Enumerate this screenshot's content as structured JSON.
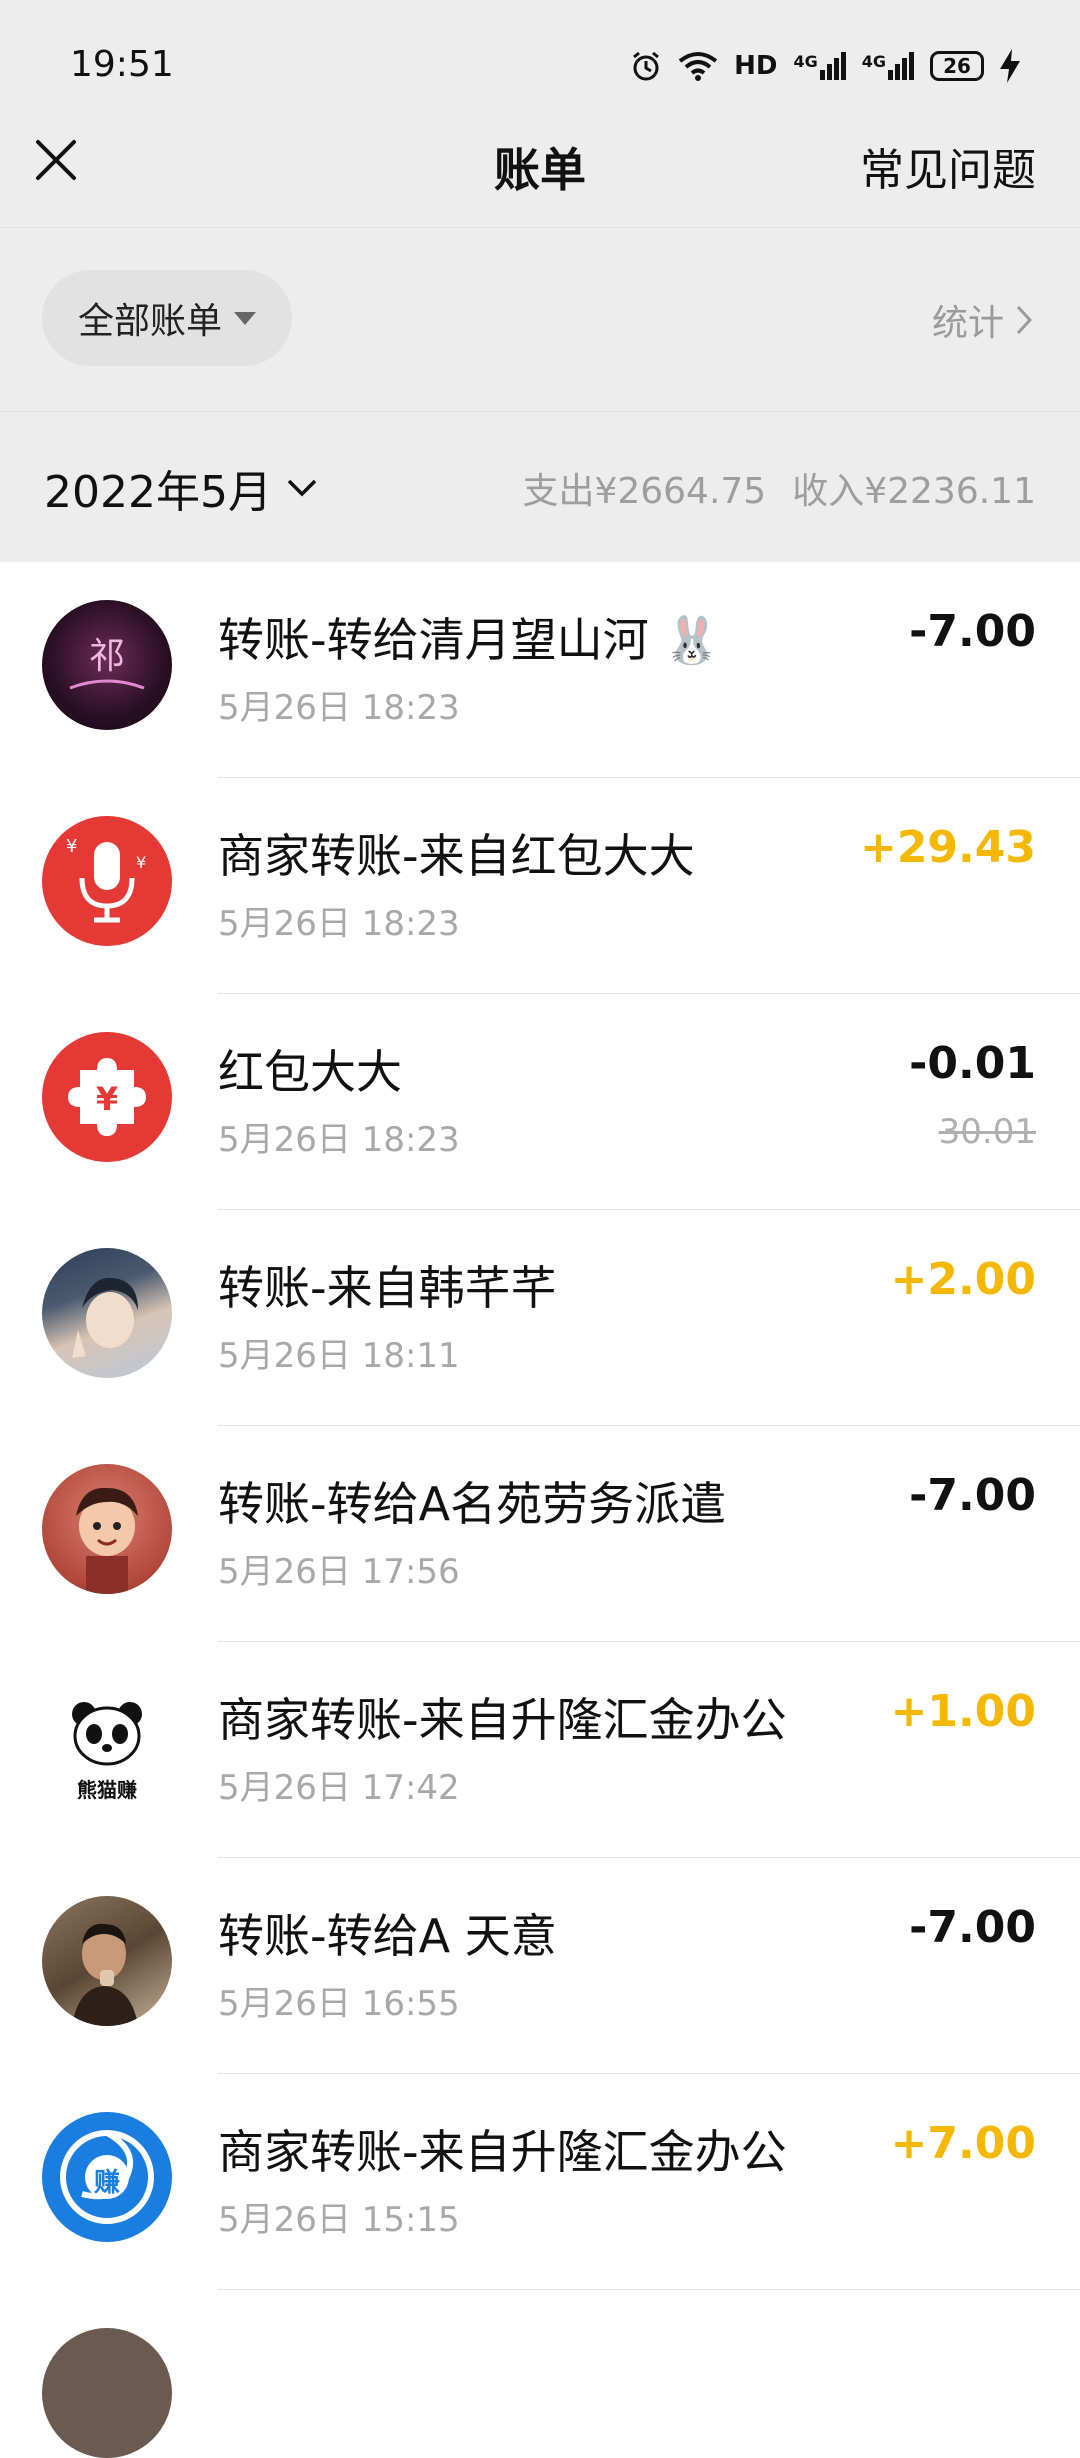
{
  "status_bar": {
    "time": "19:51",
    "network_label": "HD",
    "signal1_label": "4G",
    "signal2_label": "4G",
    "battery_level": "26"
  },
  "header": {
    "title": "账单",
    "faq_label": "常见问题",
    "close_icon": "close-icon"
  },
  "filter": {
    "all_bills_label": "全部账单",
    "stats_label": "统计"
  },
  "month": {
    "label": "2022年5月",
    "expense_summary": "支出¥2664.75",
    "income_summary": "收入¥2236.11"
  },
  "transactions": [
    {
      "title": "转账-转给清月望山河 🐰",
      "time": "5月26日 18:23",
      "amount": "-7.00",
      "type": "expense",
      "avatar": "dark-purple-avatar"
    },
    {
      "title": "商家转账-来自红包大大",
      "time": "5月26日 18:23",
      "amount": "+29.43",
      "type": "income",
      "avatar": "red-microphone-avatar"
    },
    {
      "title": "红包大大",
      "time": "5月26日 18:23",
      "amount": "-0.01",
      "original_amount": "30.01",
      "type": "expense",
      "avatar": "red-puzzle-avatar"
    },
    {
      "title": "转账-来自韩芊芊",
      "time": "5月26日 18:11",
      "amount": "+2.00",
      "type": "income",
      "avatar": "person-photo-avatar"
    },
    {
      "title": "转账-转给A名苑劳务派遣",
      "time": "5月26日 17:56",
      "amount": "-7.00",
      "type": "expense",
      "avatar": "cartoon-avatar"
    },
    {
      "title": "商家转账-来自升隆汇金办公",
      "time": "5月26日 17:42",
      "amount": "+1.00",
      "type": "income",
      "avatar": "panda-avatar",
      "avatar_text": "熊猫赚"
    },
    {
      "title": "转账-转给A 天意",
      "time": "5月26日 16:55",
      "amount": "-7.00",
      "type": "expense",
      "avatar": "man-photo-avatar"
    },
    {
      "title": "商家转账-来自升隆汇金办公",
      "time": "5月26日 15:15",
      "amount": "+7.00",
      "type": "income",
      "avatar": "blue-swirl-avatar",
      "avatar_text": "赚"
    }
  ],
  "colors": {
    "income": "#f5b800",
    "expense": "#111111",
    "header_bg": "#ededed"
  }
}
